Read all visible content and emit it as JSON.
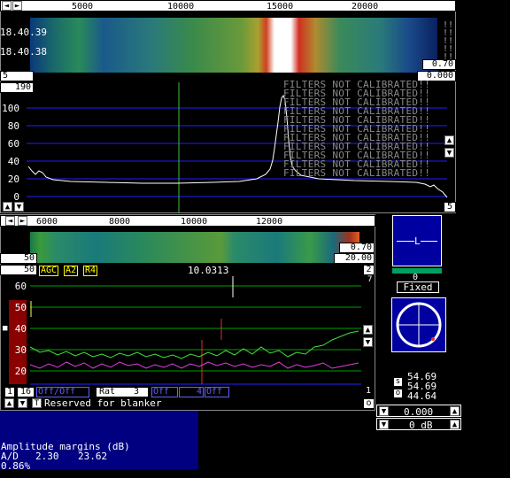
{
  "top_waterfall": {
    "freq_ticks": [
      "5000",
      "10000",
      "15000",
      "20000"
    ],
    "times": [
      "18.40.39",
      "18.40.38"
    ],
    "value_a": "0.70",
    "value_b": "0.000",
    "left_num": "5"
  },
  "top_spectrum": {
    "avg_value": "190",
    "y_labels": [
      "100",
      "80",
      "60",
      "40",
      "20",
      "0"
    ],
    "warning": "FILTERS NOT CALIBRATED!!",
    "corner_num": "5"
  },
  "lower_waterfall": {
    "freq_ticks": [
      "6000",
      "8000",
      "10000",
      "12000"
    ],
    "left_num": "50",
    "value_a": "0.70",
    "value_b": "20.00"
  },
  "lower_spectrum": {
    "avg_value": "50",
    "tags": [
      "AGC",
      "A2",
      "R4"
    ],
    "frequency": "10.0313",
    "right_num": "2",
    "right_small": "7",
    "y_labels": [
      "60",
      "50",
      "40",
      "30",
      "20"
    ],
    "bottom_right_num": "1"
  },
  "bottom_controls": {
    "num_1": "1",
    "num_16": "16",
    "off_a": "Off/Off",
    "rat_label": "Rat",
    "rat_value": "3",
    "off_b": "Off",
    "num_4": "4",
    "off_c": "Off",
    "blanker_text": "Reserved for blanker",
    "o_label": "o"
  },
  "s_meter": {
    "letter": "L",
    "value": "0",
    "mode": "Fixed"
  },
  "readouts": {
    "s": "54.69",
    "n": "54.69",
    "o": "44.64",
    "labels": [
      "s",
      "n",
      "o"
    ],
    "gain": "0.000",
    "db": "0 dB"
  },
  "amplitude": {
    "title": "Amplitude margins (dB)",
    "ad_label": "A/D",
    "ad_low": "2.30",
    "ad_high": "23.62",
    "percent": "0.86%"
  },
  "colors": {
    "grid_blue": "#2020ff",
    "grid_green": "#00a000",
    "meter_red": "#8b0000"
  }
}
